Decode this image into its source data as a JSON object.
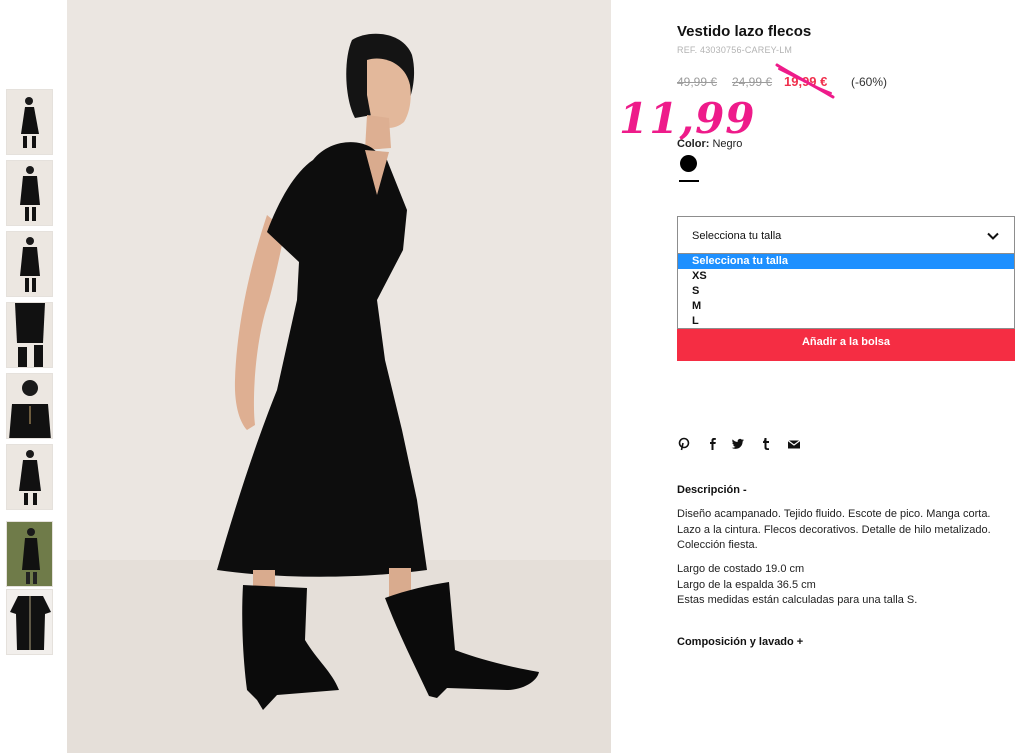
{
  "product": {
    "title": "Vestido lazo flecos",
    "ref": "REF. 43030756-CAREY-LM",
    "price_original": "49,99 €",
    "price_previous": "24,99 €",
    "price_current": "19,99 €",
    "discount": "(-60%)",
    "handwritten_price": "11,99",
    "color_label": "Color:",
    "color_value": "Negro"
  },
  "size_selector": {
    "placeholder": "Selecciona tu talla",
    "options": [
      "Selecciona tu talla",
      "XS",
      "S",
      "M",
      "L"
    ],
    "selected_index": 0
  },
  "add_to_bag_label": "Añadir a la bolsa",
  "social_icons": [
    "pinterest-icon",
    "facebook-icon",
    "twitter-icon",
    "tumblr-icon",
    "email-icon"
  ],
  "description": {
    "title": "Descripción -",
    "text": "Diseño acampanado. Tejido fluido. Escote de pico. Manga corta. Lazo a la cintura. Flecos decorativos. Detalle de hilo metalizado. Colección fiesta.",
    "measures": [
      "Largo de costado 19.0 cm",
      "Largo de la espalda 36.5 cm",
      "Estas medidas están calculadas para una talla S."
    ]
  },
  "composition": {
    "title": "Composición y lavado +"
  },
  "colors": {
    "accent_red": "#f52d43",
    "sale_red": "#f0304d",
    "handwritten_pink": "#ee1b8a",
    "selected_option_blue": "#1e90ff"
  }
}
